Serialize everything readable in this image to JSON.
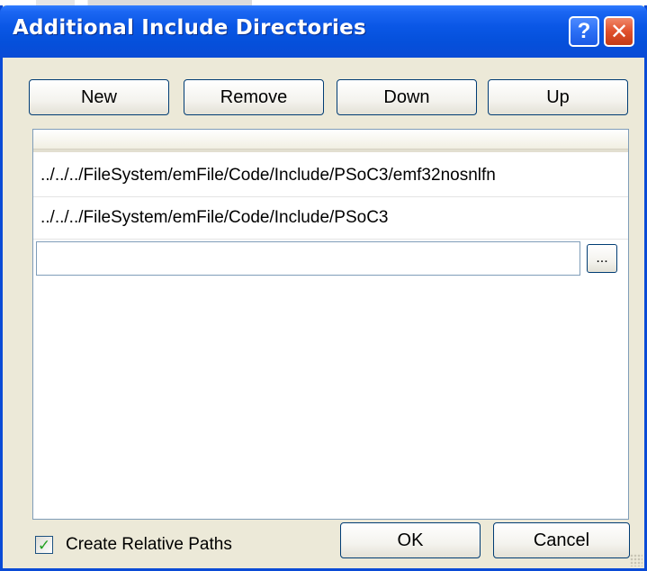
{
  "window": {
    "title": "Additional Include Directories",
    "help_label": "?",
    "close_label": "✕"
  },
  "toolbar": {
    "new_label": "New",
    "remove_label": "Remove",
    "down_label": "Down",
    "up_label": "Up"
  },
  "list": {
    "items": [
      {
        "path": "../../../FileSystem/emFile/Code/Include/PSoC3/emf32nosnlfn"
      },
      {
        "path": "../../../FileSystem/emFile/Code/Include/PSoC3"
      }
    ],
    "edit_value": "",
    "browse_label": "..."
  },
  "options": {
    "relative_paths_label": "Create Relative Paths",
    "relative_paths_checked": true
  },
  "footer": {
    "ok_label": "OK",
    "cancel_label": "Cancel"
  },
  "colors": {
    "titlebar": "#0a4bd6",
    "dialog_bg": "#ece9d8",
    "close_button": "#e0502c",
    "check_mark": "#21a121"
  }
}
